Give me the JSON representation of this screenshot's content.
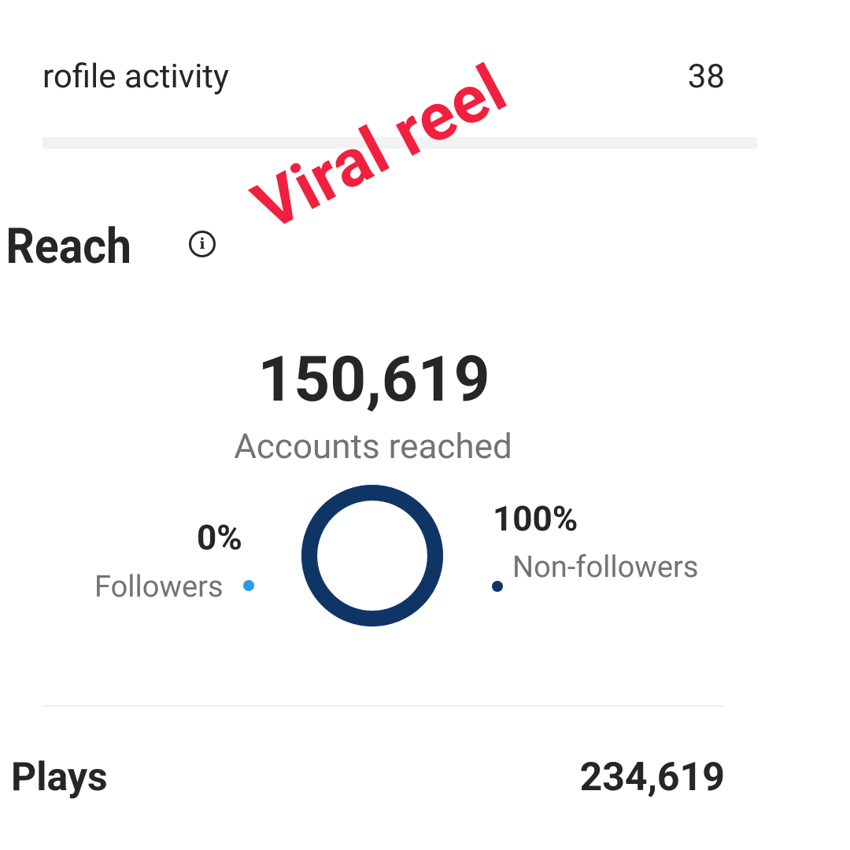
{
  "profile_activity": {
    "label": "rofile activity",
    "value": "38"
  },
  "reach": {
    "title": "Reach",
    "info_icon": "info-circle-icon",
    "accounts_reached_value": "150,619",
    "accounts_reached_label": "Accounts reached",
    "followers": {
      "percent_label": "0%",
      "label": "Followers",
      "percent": 0,
      "color": "#2b9ae8"
    },
    "non_followers": {
      "percent_label": "100%",
      "label": "Non-followers",
      "percent": 100,
      "color": "#0f3566"
    }
  },
  "annotation": {
    "text": "Viral reel",
    "color": "#f0203e"
  },
  "plays": {
    "label": "Plays",
    "value": "234,619"
  }
}
